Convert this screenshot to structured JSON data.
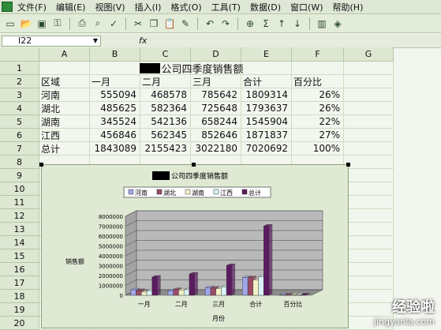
{
  "menu": [
    "文件(F)",
    "编辑(E)",
    "视图(V)",
    "插入(I)",
    "格式(O)",
    "工具(T)",
    "数据(D)",
    "窗口(W)",
    "帮助(H)"
  ],
  "toolbar_icons": [
    "new-icon",
    "open-icon",
    "save-icon",
    "permission-icon",
    "print-icon",
    "preview-icon",
    "spell-icon",
    "cut-icon",
    "copy-icon",
    "paste-icon",
    "format-painter-icon",
    "undo-icon",
    "redo-icon",
    "hyperlink-icon",
    "autosum-icon",
    "sort-asc-icon",
    "sort-desc-icon",
    "chart-icon",
    "drawing-icon"
  ],
  "namebox": "I22",
  "fx": "fx",
  "columns": [
    "A",
    "B",
    "C",
    "D",
    "E",
    "F",
    "G"
  ],
  "rows": [
    "1",
    "2",
    "3",
    "4",
    "5",
    "6",
    "7",
    "8",
    "9",
    "10",
    "11",
    "12",
    "13",
    "14",
    "15",
    "16",
    "17",
    "18",
    "19",
    "20"
  ],
  "sheet": {
    "title": "公司四季度销售额",
    "header": [
      "区域",
      "一月",
      "二月",
      "三月",
      "合计",
      "百分比"
    ],
    "data": [
      [
        "河南",
        "555094",
        "468578",
        "785642",
        "1809314",
        "26%"
      ],
      [
        "湖北",
        "485625",
        "582364",
        "725648",
        "1793637",
        "26%"
      ],
      [
        "湖南",
        "345524",
        "542136",
        "658244",
        "1545904",
        "22%"
      ],
      [
        "江西",
        "456846",
        "562345",
        "852646",
        "1871837",
        "27%"
      ],
      [
        "总计",
        "1843089",
        "2155423",
        "3022180",
        "7020692",
        "100%"
      ]
    ]
  },
  "chart_data": {
    "type": "bar",
    "title": "公司四季度销售额",
    "xlabel": "月份",
    "ylabel": "销售额",
    "categories": [
      "一月",
      "二月",
      "三月",
      "合计",
      "百分比"
    ],
    "series": [
      {
        "name": "河南",
        "values": [
          555094,
          468578,
          785642,
          1809314,
          0.26
        ],
        "color": "#9fa7ea"
      },
      {
        "name": "湖北",
        "values": [
          485625,
          582364,
          725648,
          1793637,
          0.26
        ],
        "color": "#9a4b66"
      },
      {
        "name": "湖南",
        "values": [
          345524,
          542136,
          658244,
          1545904,
          0.22
        ],
        "color": "#f2f2c6"
      },
      {
        "name": "江西",
        "values": [
          456846,
          562345,
          852646,
          1871837,
          0.27
        ],
        "color": "#d8f2f5"
      },
      {
        "name": "总计",
        "values": [
          1843089,
          2155423,
          3022180,
          7020692,
          1
        ],
        "color": "#5c1a60"
      }
    ],
    "yticks": [
      "0",
      "1000000",
      "2000000",
      "3000000",
      "4000000",
      "5000000",
      "6000000",
      "7000000",
      "8000000"
    ],
    "ylim": [
      0,
      8000000
    ],
    "legend_position": "top",
    "grid": true
  },
  "watermark": {
    "line1": "经验啦",
    "line2": "jingyanla.com"
  }
}
